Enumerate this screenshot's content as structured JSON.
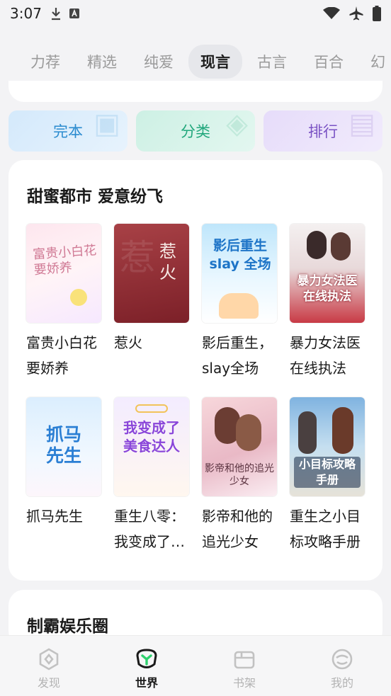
{
  "status_bar": {
    "time": "3:07"
  },
  "tabs": [
    {
      "label": "力荐",
      "active": false
    },
    {
      "label": "精选",
      "active": false
    },
    {
      "label": "纯爱",
      "active": false
    },
    {
      "label": "现言",
      "active": true
    },
    {
      "label": "古言",
      "active": false
    },
    {
      "label": "百合",
      "active": false
    },
    {
      "label": "幻",
      "active": false
    }
  ],
  "quick_buttons": [
    {
      "label": "完本",
      "color": "#2a8bcf",
      "bg": "#dcedfb"
    },
    {
      "label": "分类",
      "color": "#21a77c",
      "bg": "#d6f3ea"
    },
    {
      "label": "排行",
      "color": "#7a52c4",
      "bg": "#ece4fb"
    }
  ],
  "sections": [
    {
      "title": "甜蜜都市 爱意纷飞",
      "books": [
        {
          "title": "富贵小白花要娇养",
          "cover_text": "富贵小白花要娇养"
        },
        {
          "title": "惹火",
          "cover_text": "惹火"
        },
        {
          "title": "影后重生，slay全场",
          "cover_text": "影后重生 slay 全场"
        },
        {
          "title": "暴力女法医在线执法",
          "cover_text": "暴力女法医在线执法"
        },
        {
          "title": "抓马先生",
          "cover_text": "抓马先生"
        },
        {
          "title": "重生八零：我变成了美食达人",
          "cover_text": "我变成了美食达人"
        },
        {
          "title": "影帝和他的追光少女",
          "cover_text": "影帝和他的追光少女"
        },
        {
          "title": "重生之小目标攻略手册",
          "cover_text": "小目标攻略手册"
        }
      ]
    },
    {
      "title": "制霸娱乐圈",
      "books": []
    }
  ],
  "bottom_nav": [
    {
      "label": "发现",
      "icon": "discover-icon",
      "active": false
    },
    {
      "label": "世界",
      "icon": "world-icon",
      "active": true
    },
    {
      "label": "书架",
      "icon": "bookshelf-icon",
      "active": false
    },
    {
      "label": "我的",
      "icon": "profile-icon",
      "active": false
    }
  ]
}
